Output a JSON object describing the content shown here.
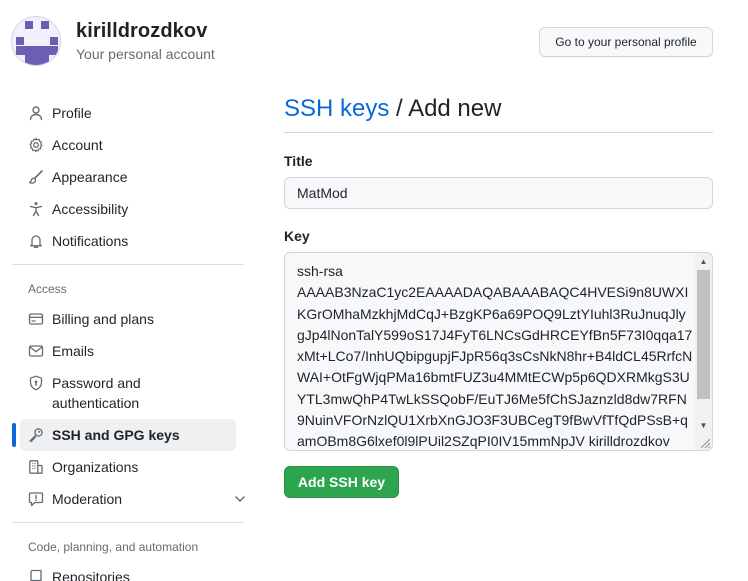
{
  "header": {
    "username": "kirilldrozdkov",
    "subtitle": "Your personal account",
    "profile_button": "Go to your personal profile"
  },
  "sidebar": {
    "items": [
      {
        "label": "Profile",
        "icon": "person-icon"
      },
      {
        "label": "Account",
        "icon": "gear-icon"
      },
      {
        "label": "Appearance",
        "icon": "paintbrush-icon"
      },
      {
        "label": "Accessibility",
        "icon": "accessibility-icon"
      },
      {
        "label": "Notifications",
        "icon": "bell-icon"
      }
    ],
    "access_heading": "Access",
    "access_items": [
      {
        "label": "Billing and plans",
        "icon": "credit-card-icon"
      },
      {
        "label": "Emails",
        "icon": "mail-icon"
      },
      {
        "label": "Password and",
        "label2": "authentication",
        "icon": "shield-lock-icon"
      },
      {
        "label": "SSH and GPG keys",
        "icon": "key-icon",
        "active": true
      },
      {
        "label": "Organizations",
        "icon": "organization-icon"
      },
      {
        "label": "Moderation",
        "icon": "report-icon"
      }
    ],
    "code_heading": "Code, planning, and automation",
    "code_items": [
      {
        "label": "Repositories",
        "icon": "repo-icon"
      }
    ]
  },
  "main": {
    "breadcrumb": "SSH keys",
    "separator": " / ",
    "heading": "Add new",
    "title_label": "Title",
    "title_value": "MatMod",
    "key_label": "Key",
    "key_text": "ssh-rsa\nAAAAB3NzaC1yc2EAAAADAQABAAABAQC4HVESi9n8UWXIKGrOMhaMzkhjMdCqJ+BzgKP6a69POQ9LztYIuhl3RuJnuqJlygJp4lNonTalY599oS17J4FyT6LNCsGdHRCEYfBn5F73I0qqa17xMt+LCo7/InhUQbipgupjFJpR56q3sCsNkN8hr+B4ldCL45RrfcNWAI+OtFgWjqPMa16bmtFUZ3u4MMtECWp5p6QDXRMkgS3UYTL3mwQhP4TwLkSSQobF/EuTJ6Me5fChSJaznzld8dw7RFN9NuinVFOrNzlQU1XrbXnGJO3F3UBCegT9fBwVfTfQdPSsB+qamOBm8G6lxef0l9lPUil2SZqPI0IV15mmNpJV ",
    "key_user": "kirilldrozdkov",
    "submit_button": "Add SSH key"
  },
  "colors": {
    "link": "#0969da",
    "primary_button": "#2da44e",
    "active_indicator": "#0969da",
    "avatar": "#6b5fb5"
  }
}
